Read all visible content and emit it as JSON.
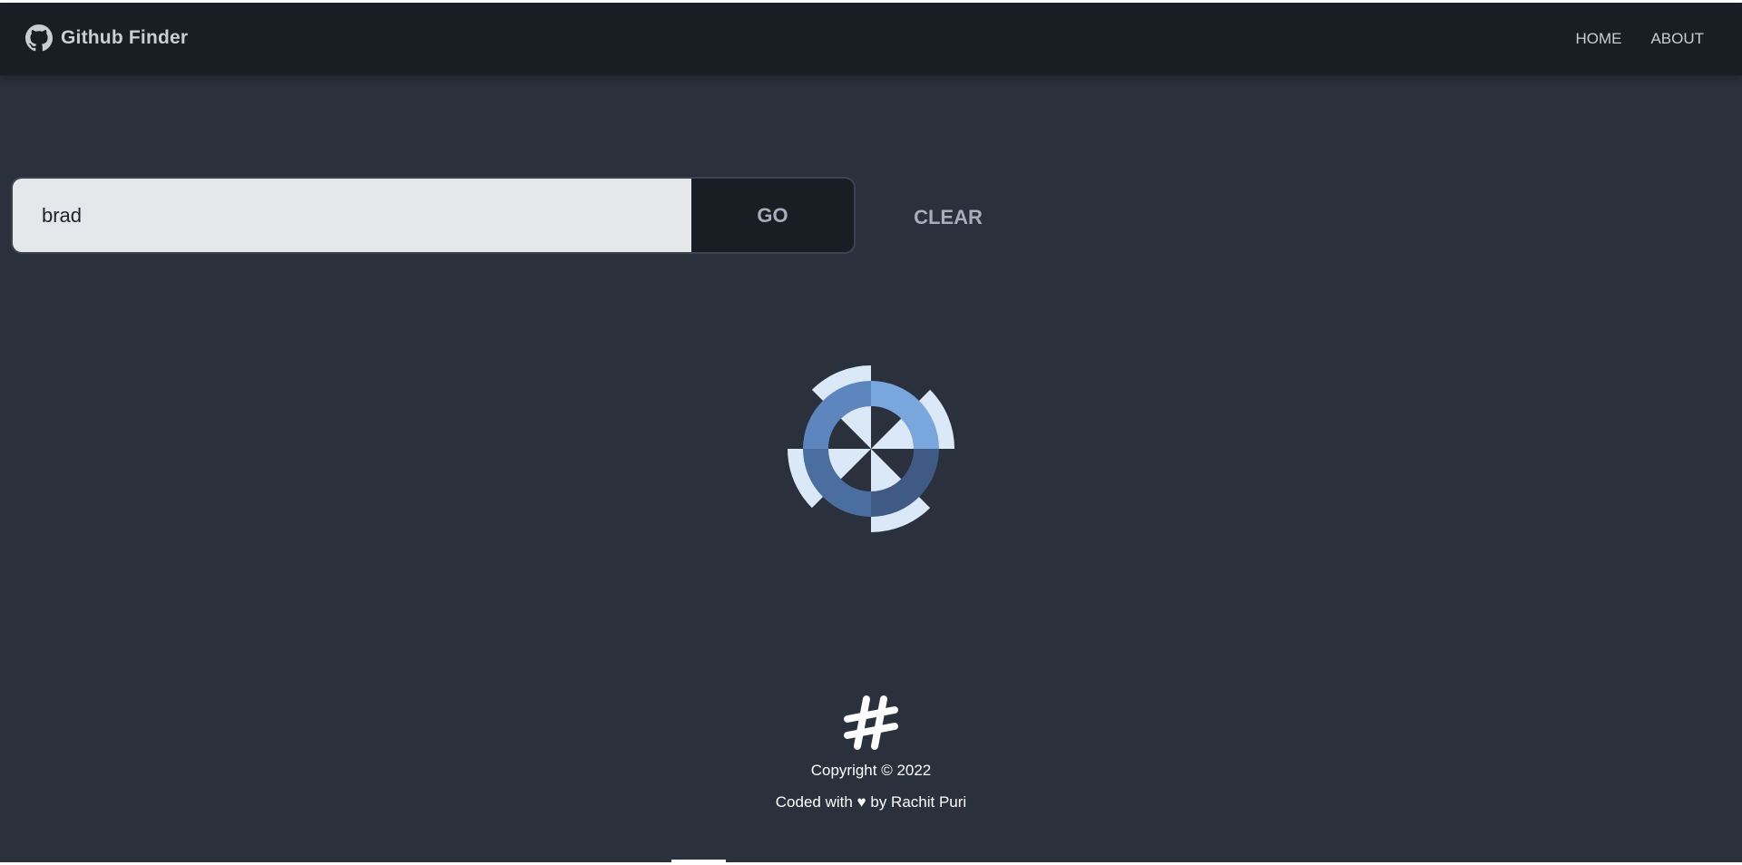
{
  "header": {
    "brand": "Github Finder",
    "brand_icon": "github-icon",
    "nav": [
      {
        "label": "HOME"
      },
      {
        "label": "ABOUT"
      }
    ]
  },
  "search": {
    "value": "brad",
    "go_label": "GO",
    "clear_label": "CLEAR"
  },
  "loading": {
    "icon": "spinner-icon",
    "colors": {
      "light": "#dbe8f7",
      "mid": "#6b9ad1",
      "dark": "#3c5378"
    }
  },
  "footer": {
    "logo_icon": "hash-icon",
    "copyright": "Copyright © 2022",
    "credit": "Coded with ♥ by Rachit Puri"
  },
  "colors": {
    "background": "#2a303c",
    "navbar": "#191d24",
    "input": "#e5e7eb",
    "button": "#191d24",
    "text_muted": "#a6adbb"
  }
}
